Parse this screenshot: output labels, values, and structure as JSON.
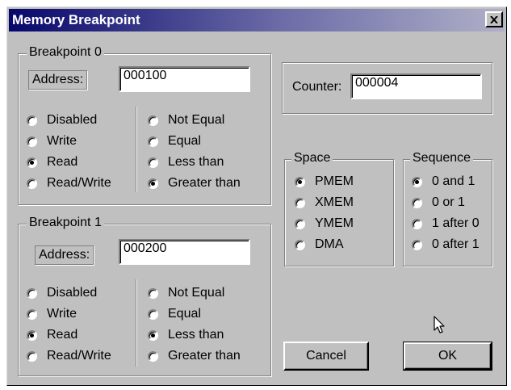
{
  "dialog": {
    "title": "Memory Breakpoint",
    "close_glyph": "×"
  },
  "bp0": {
    "title": "Breakpoint 0",
    "address_label": "Address:",
    "address_value": "000100",
    "access": [
      "Disabled",
      "Write",
      "Read",
      "Read/Write"
    ],
    "access_selected": "Read",
    "compare": [
      "Not Equal",
      "Equal",
      "Less than",
      "Greater than"
    ],
    "compare_selected": "Greater than"
  },
  "bp1": {
    "title": "Breakpoint 1",
    "address_label": "Address:",
    "address_value": "000200",
    "access": [
      "Disabled",
      "Write",
      "Read",
      "Read/Write"
    ],
    "access_selected": "Read",
    "compare": [
      "Not Equal",
      "Equal",
      "Less than",
      "Greater than"
    ],
    "compare_selected": "Less than"
  },
  "counter": {
    "label": "Counter:",
    "value": "000004"
  },
  "space": {
    "title": "Space",
    "options": [
      "PMEM",
      "XMEM",
      "YMEM",
      "DMA"
    ],
    "selected": "PMEM"
  },
  "sequence": {
    "title": "Sequence",
    "options": [
      "0 and 1",
      "0 or 1",
      "1 after 0",
      "0 after 1"
    ],
    "selected": "0 and 1"
  },
  "buttons": {
    "cancel": "Cancel",
    "ok": "OK"
  },
  "colors": {
    "face": "#c0c0c0",
    "title_start": "#07076b",
    "title_end": "#b0b0c8"
  },
  "icons": {
    "close": "close-icon",
    "cursor": "mouse-pointer-icon"
  }
}
